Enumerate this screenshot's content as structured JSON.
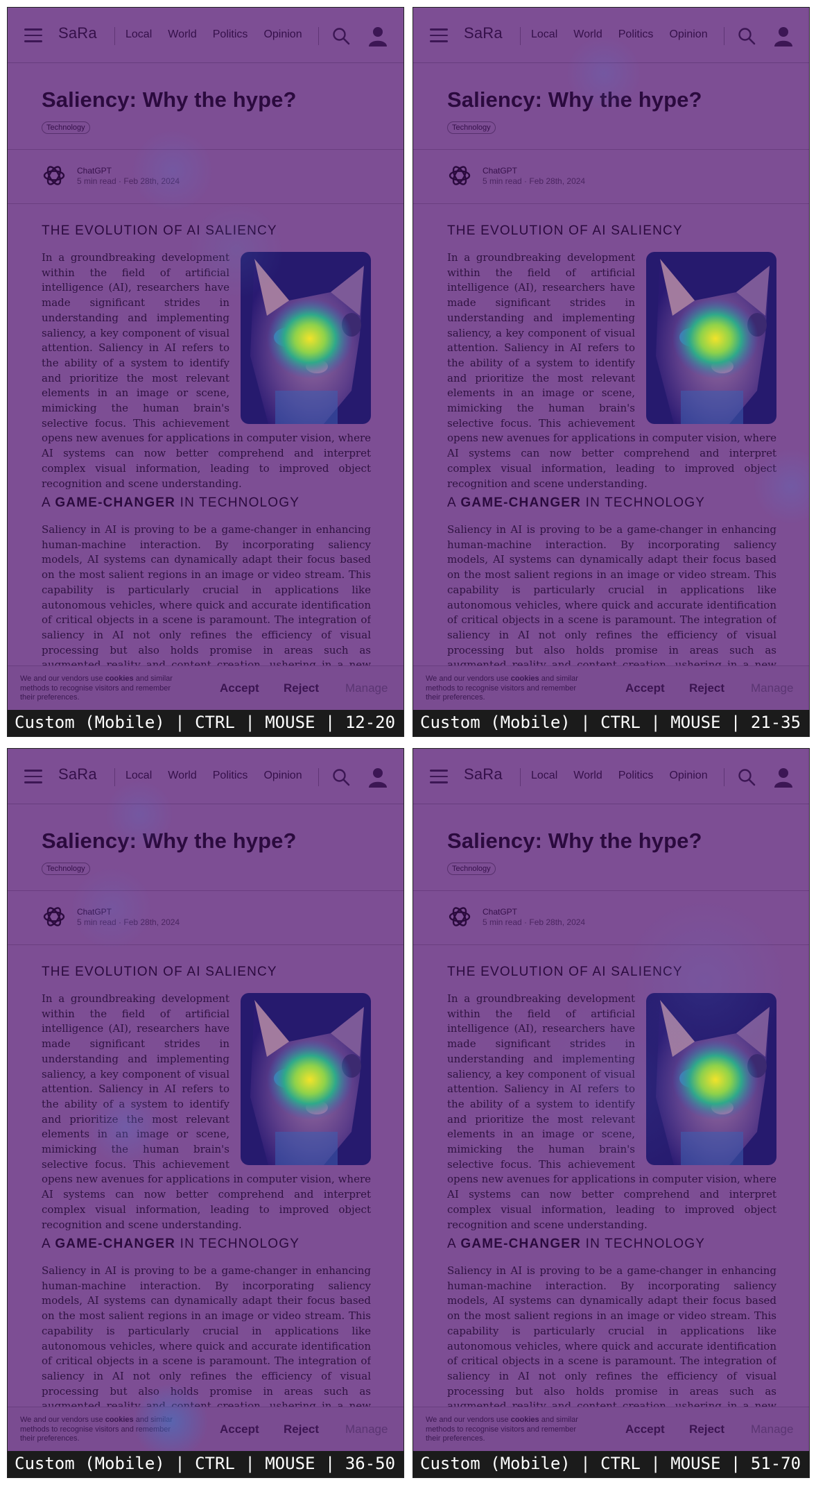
{
  "nav": {
    "brand": "SaRa",
    "links": [
      "Local",
      "World",
      "Politics",
      "Opinion"
    ]
  },
  "article": {
    "title": "Saliency: Why the hype?",
    "tag": "Technology",
    "author": "ChatGPT",
    "meta": "5 min read · Feb 28th, 2024",
    "section1_heading": "THE EVOLUTION OF AI SALIENCY",
    "section1_text": "In a groundbreaking development within the field of artificial intelligence (AI), researchers have made significant strides in understanding and implementing saliency, a key component of visual attention. Saliency in AI refers to the ability of a system to identify and prioritize the most relevant elements in an image or scene, mimicking the human brain's selective focus. This achievement opens new avenues for applications in computer vision, where AI systems can now better comprehend and interpret complex visual information, leading to improved object recognition and scene understanding.",
    "section2_heading_a": "A ",
    "section2_heading_b": "GAME-CHANGER",
    "section2_heading_c": " IN TECHNOLOGY",
    "section2_text": "Saliency in AI is proving to be a game-changer in enhancing human-machine interaction. By incorporating saliency models, AI systems can dynamically adapt their focus based on the most salient regions in an image or video stream. This capability is particularly crucial in applications like autonomous vehicles, where quick and accurate identification of critical objects in a scene is paramount. The integration of saliency in AI not only refines the efficiency of visual processing but also holds promise in areas such as augmented reality and content creation, ushering in a new era of seamless human-AI collaboration."
  },
  "cookie": {
    "text_a": "We and our vendors use ",
    "text_b": "cookies",
    "text_c": " and similar methods to recognise visitors and remember their preferences.",
    "accept": "Accept",
    "reject": "Reject",
    "manage": "Manage"
  },
  "panels": [
    {
      "label": "Custom (Mobile) | CTRL | MOUSE | 12-20"
    },
    {
      "label": "Custom (Mobile) | CTRL | MOUSE | 21-35"
    },
    {
      "label": "Custom (Mobile) | CTRL | MOUSE | 36-50"
    },
    {
      "label": "Custom (Mobile) | CTRL | MOUSE | 51-70"
    }
  ],
  "colors": {
    "overlay": "#7d4e94",
    "text": "#2b0a3e",
    "footer_bg": "#1b1b1b",
    "heat_hot": "#f2e32a",
    "heat_warm": "#3ec36d",
    "heat_cool": "#3160b8"
  }
}
